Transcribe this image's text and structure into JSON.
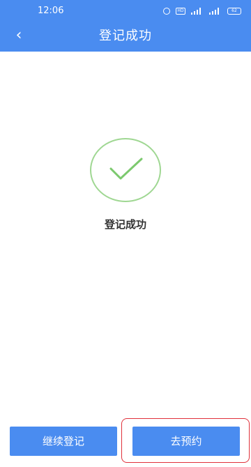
{
  "status_bar": {
    "time": "12:06",
    "icons": [
      "alarm-icon",
      "hd-icon",
      "signal-icon",
      "signal-icon",
      "battery-icon"
    ],
    "hd_label": "HD",
    "battery_label": "62"
  },
  "header": {
    "back_glyph": "‹",
    "title": "登记成功",
    "background_color": "#4a8cf0"
  },
  "result": {
    "icon": "check-icon",
    "message": "登记成功",
    "check_color": "#7cc96e"
  },
  "actions": {
    "continue_label": "继续登记",
    "reserve_label": "去预约"
  }
}
